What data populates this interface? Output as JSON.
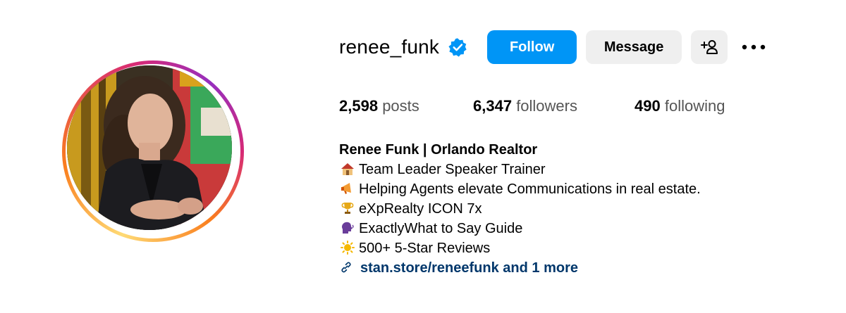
{
  "profile": {
    "username": "renee_funk",
    "verified": true,
    "follow_label": "Follow",
    "message_label": "Message",
    "add_user_icon": "add-user-icon",
    "more_icon": "more-options-icon"
  },
  "stats": {
    "posts_count": "2,598",
    "posts_label": "posts",
    "followers_count": "6,347",
    "followers_label": "followers",
    "following_count": "490",
    "following_label": "following"
  },
  "bio": {
    "name": "Renee Funk | Orlando Realtor",
    "lines": [
      {
        "icon": "house-emoji",
        "text": "Team Leader Speaker Trainer"
      },
      {
        "icon": "megaphone-emoji",
        "text": "Helping Agents elevate Communications in real estate."
      },
      {
        "icon": "trophy-emoji",
        "text": "eXpRealty ICON 7x"
      },
      {
        "icon": "speaking-head-emoji",
        "text": "ExactlyWhat to Say Guide"
      },
      {
        "icon": "sun-emoji",
        "text": "500+ 5-Star Reviews"
      }
    ],
    "link_text": "stan.store/reneefunk and 1 more"
  },
  "colors": {
    "follow_blue": "#0095f6",
    "button_gray": "#efefef",
    "link_blue": "#00376b",
    "verified_blue": "#0095f6"
  }
}
